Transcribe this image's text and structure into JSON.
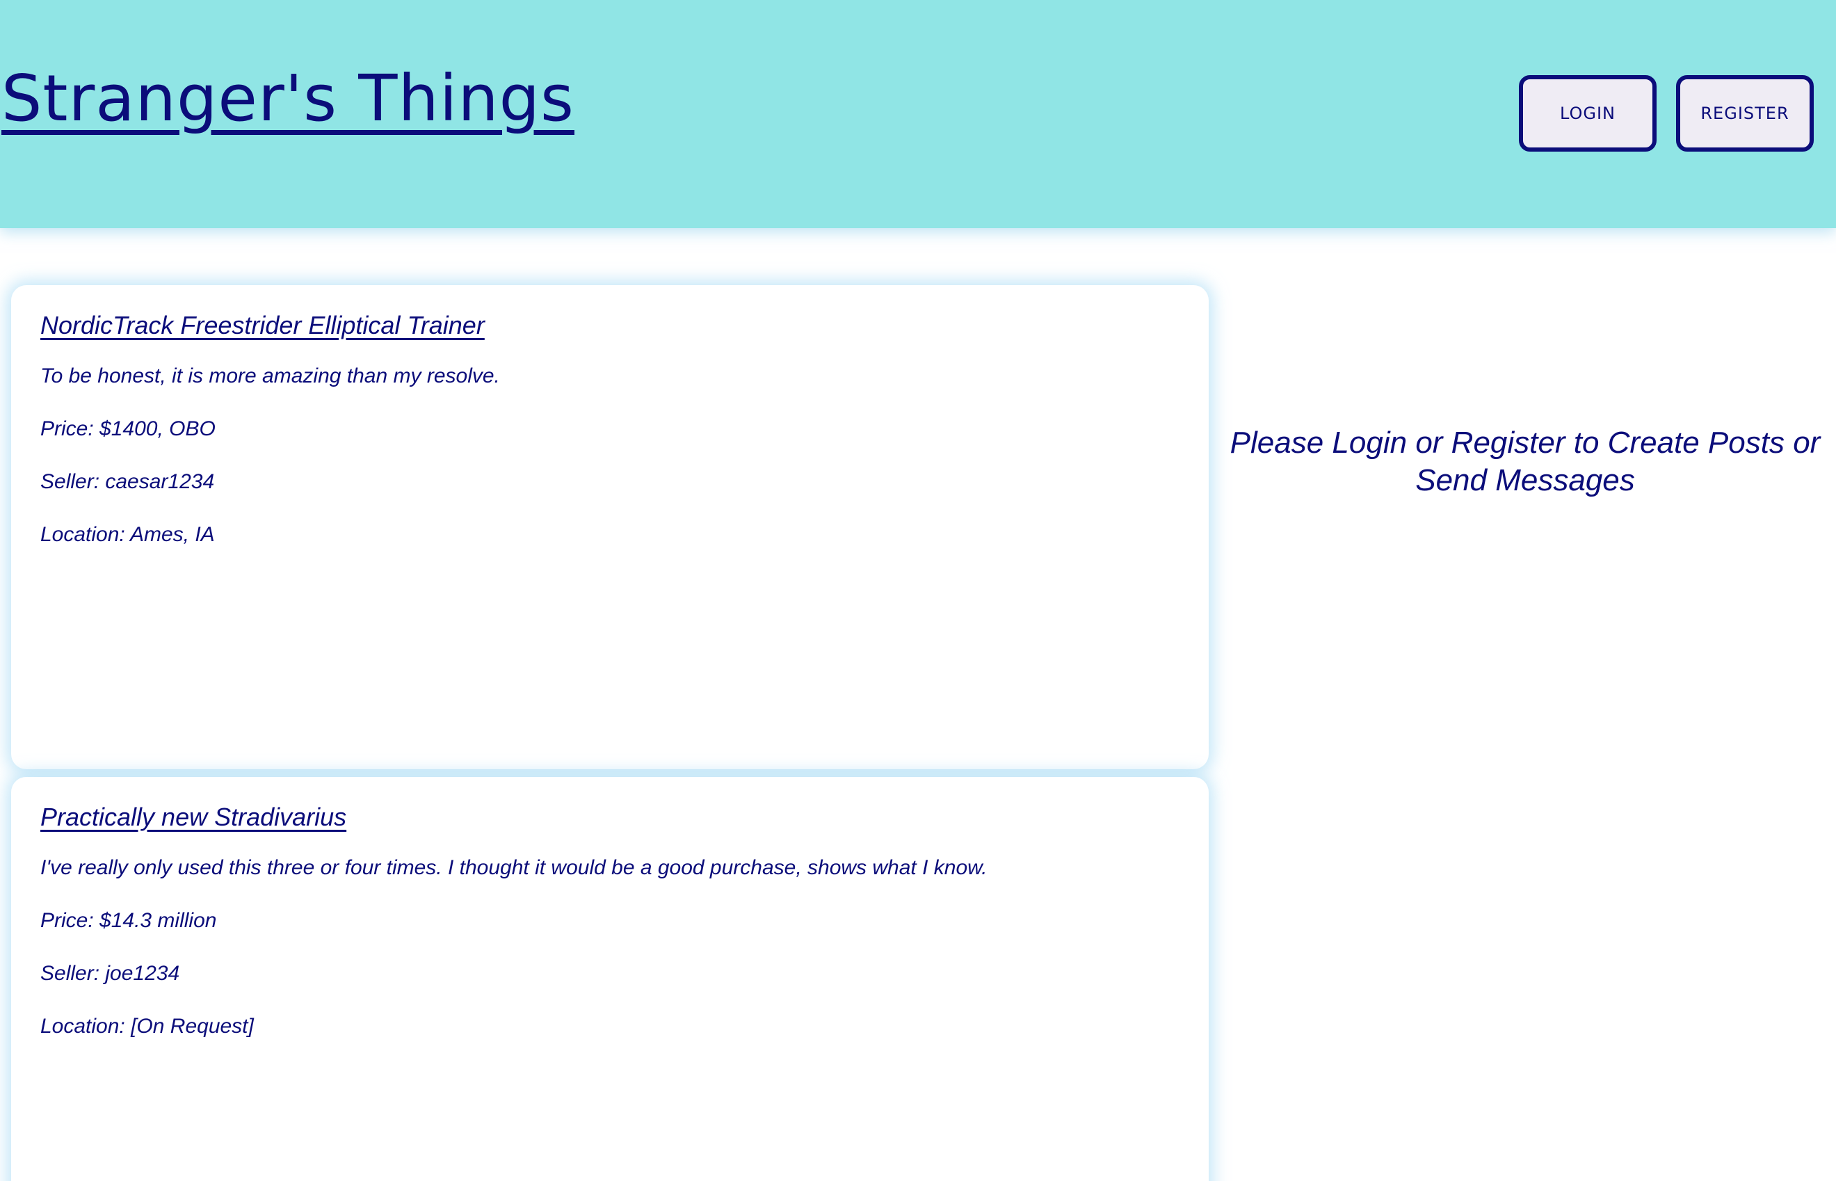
{
  "header": {
    "site_title": "Stranger's Things",
    "login_label": "LOGIN",
    "register_label": "REGISTER"
  },
  "posts": [
    {
      "title": "NordicTrack Freestrider Elliptical Trainer",
      "description": "To be honest, it is more amazing than my resolve.",
      "price": "Price: $1400, OBO",
      "seller": "Seller: caesar1234",
      "location": "Location: Ames, IA"
    },
    {
      "title": "Practically new Stradivarius",
      "description": "I've really only used this three or four times. I thought it would be a good purchase, shows what I know.",
      "price": "Price: $14.3 million",
      "seller": "Seller: joe1234",
      "location": "Location: [On Request]"
    }
  ],
  "sidebar": {
    "message": "Please Login or Register to Create Posts or Send Messages"
  },
  "colors": {
    "header_background": "#90e5e5",
    "text": "#0b0d7a",
    "button_background": "#efecf4"
  }
}
